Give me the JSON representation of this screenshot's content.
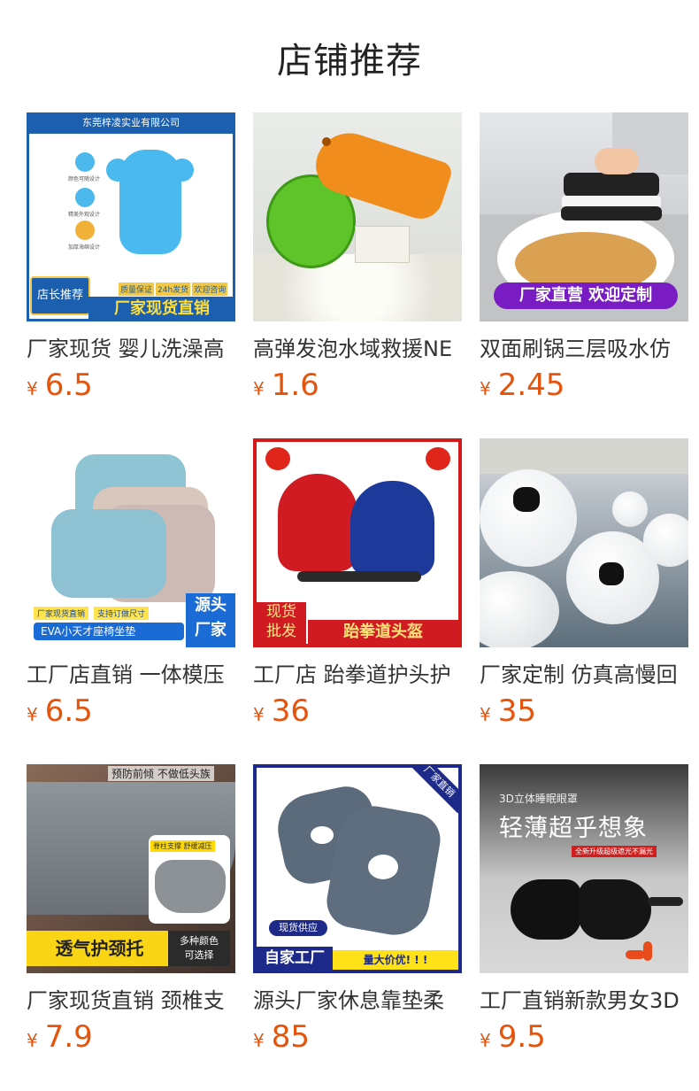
{
  "page": {
    "title": "店铺推荐"
  },
  "currency": "¥",
  "products": [
    {
      "name": "厂家现货 婴儿洗澡高",
      "price": "6.5",
      "img": {
        "company": "东莞梓凌实业有限公司",
        "badge": "店长推荐",
        "tags": [
          "质量保证",
          "24h发货",
          "欢迎咨询"
        ],
        "banner": "厂家现货直销",
        "features": [
          "颜色可随设计",
          "精美外观设计",
          "加厚海绵设计"
        ]
      }
    },
    {
      "name": "高弹发泡水域救援NE",
      "price": "1.6",
      "img": {}
    },
    {
      "name": "双面刷锅三层吸水仿",
      "price": "2.45",
      "img": {
        "banner": "厂家直营 欢迎定制"
      }
    },
    {
      "name": "工厂店直销 一体模压",
      "price": "6.5",
      "img": {
        "tags": [
          "厂家现货直销",
          "支持订做尺寸"
        ],
        "label": "EVA小天才座椅坐垫",
        "side": [
          "源头",
          "厂家"
        ]
      }
    },
    {
      "name": "工厂店 跆拳道护头护",
      "price": "36",
      "img": {
        "side": [
          "现货",
          "批发"
        ],
        "banner": "跆拳道头盔"
      }
    },
    {
      "name": "厂家定制 仿真高慢回",
      "price": "35",
      "img": {}
    },
    {
      "name": "厂家现货直销 颈椎支",
      "price": "7.9",
      "img": {
        "top": "预防前倾 不做低头族",
        "tag": "脊柱支撑 舒缓减压",
        "banner": "透气护颈托",
        "side": [
          "多种颜色",
          "可选择"
        ]
      }
    },
    {
      "name": "源头厂家休息靠垫柔",
      "price": "85",
      "img": {
        "corner": "厂家直销",
        "tag": "现货供应",
        "banner": "自家工厂",
        "sub": "量大价优! ! !"
      }
    },
    {
      "name": "工厂直销新款男女3D",
      "price": "9.5",
      "img": {
        "top": "3D立体睡眠眼罩",
        "headline": "轻薄超乎想象",
        "tag": "全新升级超级遮光不漏光"
      }
    }
  ]
}
